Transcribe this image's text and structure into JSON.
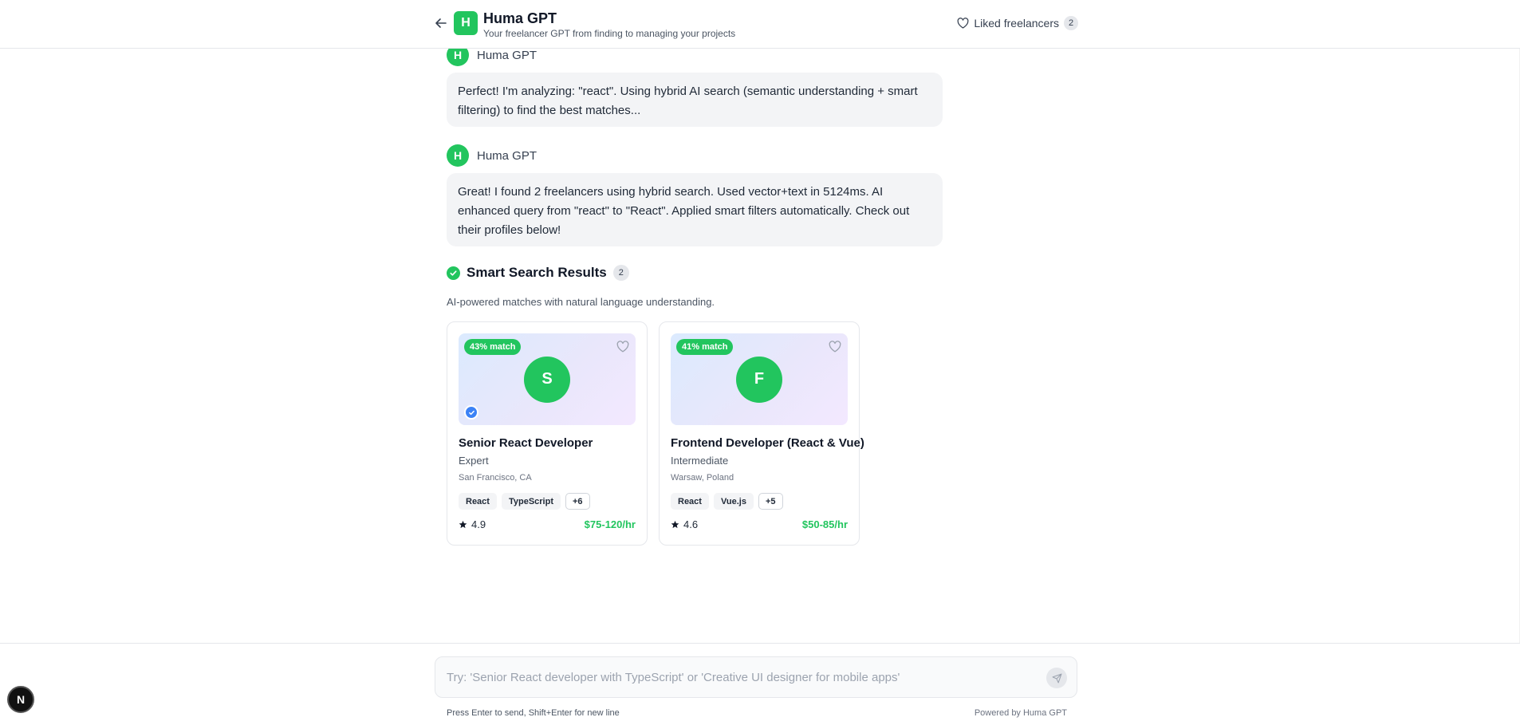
{
  "header": {
    "logo_letter": "H",
    "title": "Huma GPT",
    "subtitle": "Your freelancer GPT from finding to managing your projects",
    "liked_label": "Liked freelancers",
    "liked_count": "2"
  },
  "messages": [
    {
      "author": "Huma GPT",
      "avatar_letter": "H",
      "text": "Perfect! I'm analyzing: \"react\". Using hybrid AI search (semantic understanding + smart filtering) to find the best matches..."
    },
    {
      "author": "Huma GPT",
      "avatar_letter": "H",
      "text": "Great! I found 2 freelancers using hybrid search. Used vector+text in 5124ms. AI enhanced query from \"react\" to \"React\". Applied smart filters automatically. Check out their profiles below!"
    }
  ],
  "results": {
    "title": "Smart Search Results",
    "count": "2",
    "description": "AI-powered matches with natural language understanding."
  },
  "cards": [
    {
      "match": "43% match",
      "initial": "S",
      "verified": true,
      "title": "Senior React Developer",
      "level": "Expert",
      "location": "San Francisco, CA",
      "tags": [
        "React",
        "TypeScript"
      ],
      "more": "+6",
      "rating": "4.9",
      "rate": "$75-120/hr"
    },
    {
      "match": "41% match",
      "initial": "F",
      "verified": false,
      "title": "Frontend Developer (React & Vue)",
      "level": "Intermediate",
      "location": "Warsaw, Poland",
      "tags": [
        "React",
        "Vue.js"
      ],
      "more": "+5",
      "rating": "4.6",
      "rate": "$50-85/hr"
    }
  ],
  "composer": {
    "placeholder": "Try: 'Senior React developer with TypeScript' or 'Creative UI designer for mobile apps'",
    "value": "",
    "hint": "Press Enter to send, Shift+Enter for new line",
    "powered_by": "Powered by Huma GPT"
  },
  "dev_badge": "N",
  "icons": {
    "back": "arrow-left-icon",
    "heart": "heart-icon",
    "check": "check-circle-icon",
    "verified": "verified-check-icon",
    "star": "star-icon",
    "send": "send-icon"
  },
  "colors": {
    "brand_green": "#22c55e",
    "verified_blue": "#3b82f6",
    "bubble_bg": "#f3f4f6"
  }
}
